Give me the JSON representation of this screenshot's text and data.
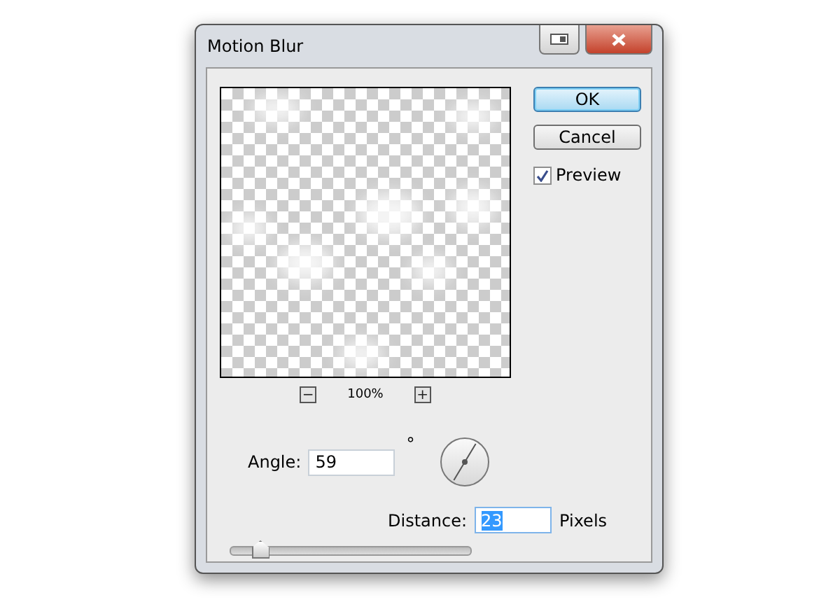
{
  "window": {
    "title": "Motion Blur"
  },
  "buttons": [
    {
      "label": "OK",
      "default": true
    },
    {
      "label": "Cancel",
      "default": false
    }
  ],
  "preview_checkbox": {
    "label": "Preview",
    "checked": true
  },
  "zoom": {
    "minus": "−",
    "value": "100%",
    "plus": "+"
  },
  "angle": {
    "label": "Angle:",
    "value": "59",
    "unit": "°"
  },
  "distance": {
    "label": "Distance:",
    "value": "23",
    "value_selected": true,
    "unit": "Pixels",
    "level": 0.12
  }
}
